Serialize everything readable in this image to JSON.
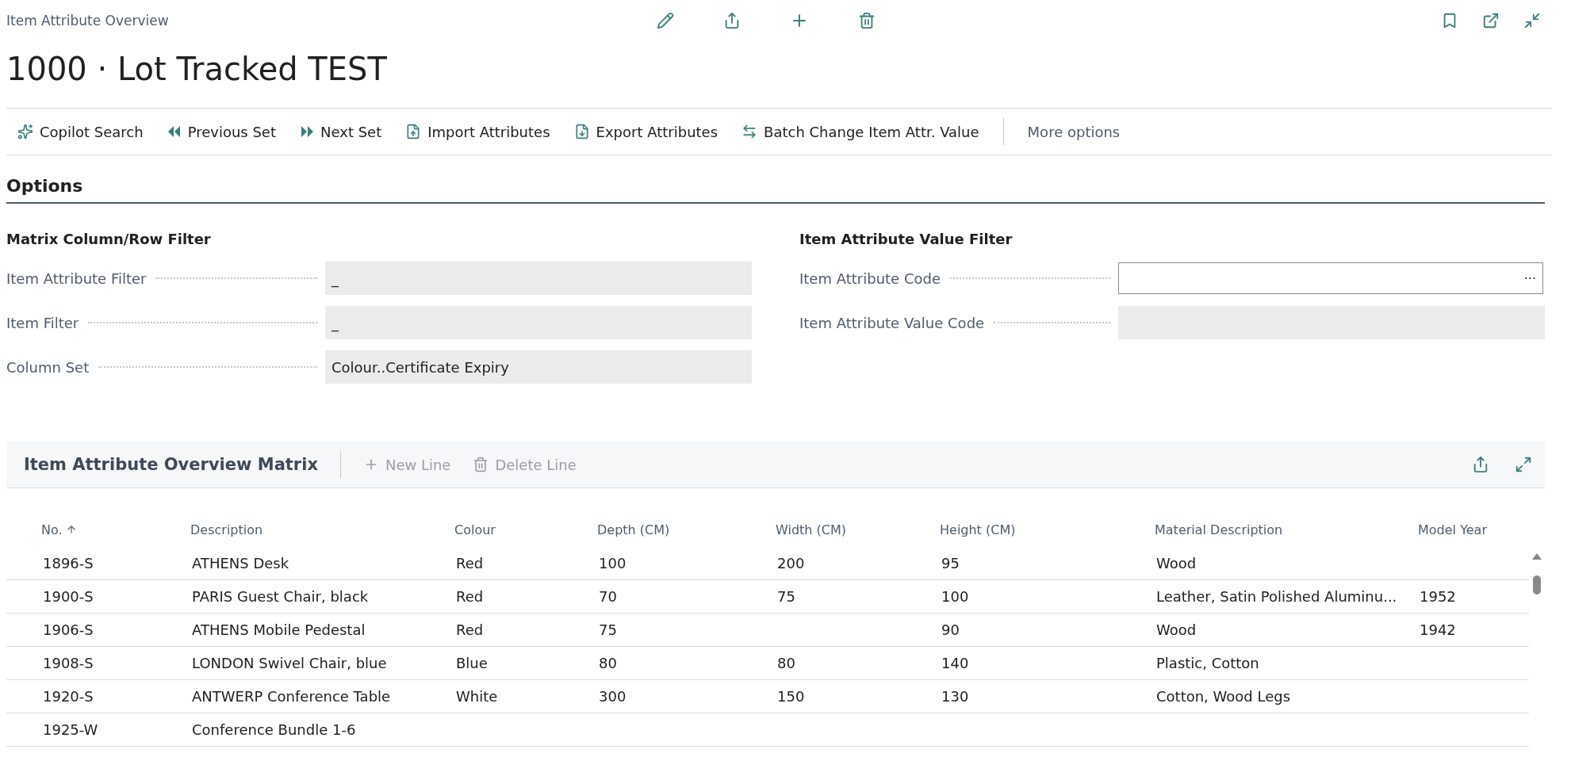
{
  "header": {
    "breadcrumb": "Item Attribute Overview",
    "title": "1000 · Lot Tracked TEST"
  },
  "actions": [
    {
      "label": "Copilot Search",
      "kind": "copilot"
    },
    {
      "label": "Previous Set",
      "kind": "previous"
    },
    {
      "label": "Next Set",
      "kind": "next"
    },
    {
      "label": "Import Attributes",
      "kind": "import"
    },
    {
      "label": "Export Attributes",
      "kind": "export"
    },
    {
      "label": "Batch Change Item Attr. Value",
      "kind": "batch"
    },
    {
      "label": "More options",
      "kind": "more"
    }
  ],
  "options": {
    "title": "Options",
    "groups": [
      {
        "title": "Matrix Column/Row Filter",
        "fields": [
          {
            "label": "Item Attribute Filter",
            "value": "_",
            "kind": "readonly"
          },
          {
            "label": "Item Filter",
            "value": "_",
            "kind": "readonly"
          },
          {
            "label": "Column Set",
            "value": "Colour..Certificate Expiry",
            "kind": "readonly"
          }
        ]
      },
      {
        "title": "Item Attribute Value Filter",
        "fields": [
          {
            "label": "Item Attribute Code",
            "kind": "lookup",
            "button": "···"
          },
          {
            "label": "Item Attribute Value Code",
            "kind": "readonly"
          }
        ]
      }
    ]
  },
  "matrix": {
    "title": "Item Attribute Overview Matrix",
    "actions": [
      {
        "label": "New Line",
        "kind": "new",
        "disabled": true
      },
      {
        "label": "Delete Line",
        "kind": "delete",
        "disabled": true
      }
    ],
    "columns": [
      {
        "label": "No.",
        "sorted": true
      },
      {
        "label": "Description",
        "sorted": false
      },
      {
        "label": "Colour",
        "sorted": false
      },
      {
        "label": "Depth (CM)",
        "sorted": false
      },
      {
        "label": "Width (CM)",
        "sorted": false
      },
      {
        "label": "Height (CM)",
        "sorted": false
      },
      {
        "label": "Material Description",
        "sorted": false
      },
      {
        "label": "Model Year",
        "sorted": false
      }
    ],
    "rows": [
      [
        "1896-S",
        "ATHENS Desk",
        "Red",
        "100",
        "200",
        "95",
        "Wood",
        ""
      ],
      [
        "1900-S",
        "PARIS Guest Chair, black",
        "Red",
        "70",
        "75",
        "100",
        "Leather, Satin Polished Aluminu...",
        "1952"
      ],
      [
        "1906-S",
        "ATHENS Mobile Pedestal",
        "Red",
        "75",
        "",
        "90",
        "Wood",
        "1942"
      ],
      [
        "1908-S",
        "LONDON Swivel Chair, blue",
        "Blue",
        "80",
        "80",
        "140",
        "Plastic, Cotton",
        ""
      ],
      [
        "1920-S",
        "ANTWERP Conference Table",
        "White",
        "300",
        "150",
        "130",
        "Cotton, Wood Legs",
        ""
      ],
      [
        "1925-W",
        "Conference Bundle 1-6",
        "",
        "",
        "",
        "",
        "",
        ""
      ]
    ]
  }
}
